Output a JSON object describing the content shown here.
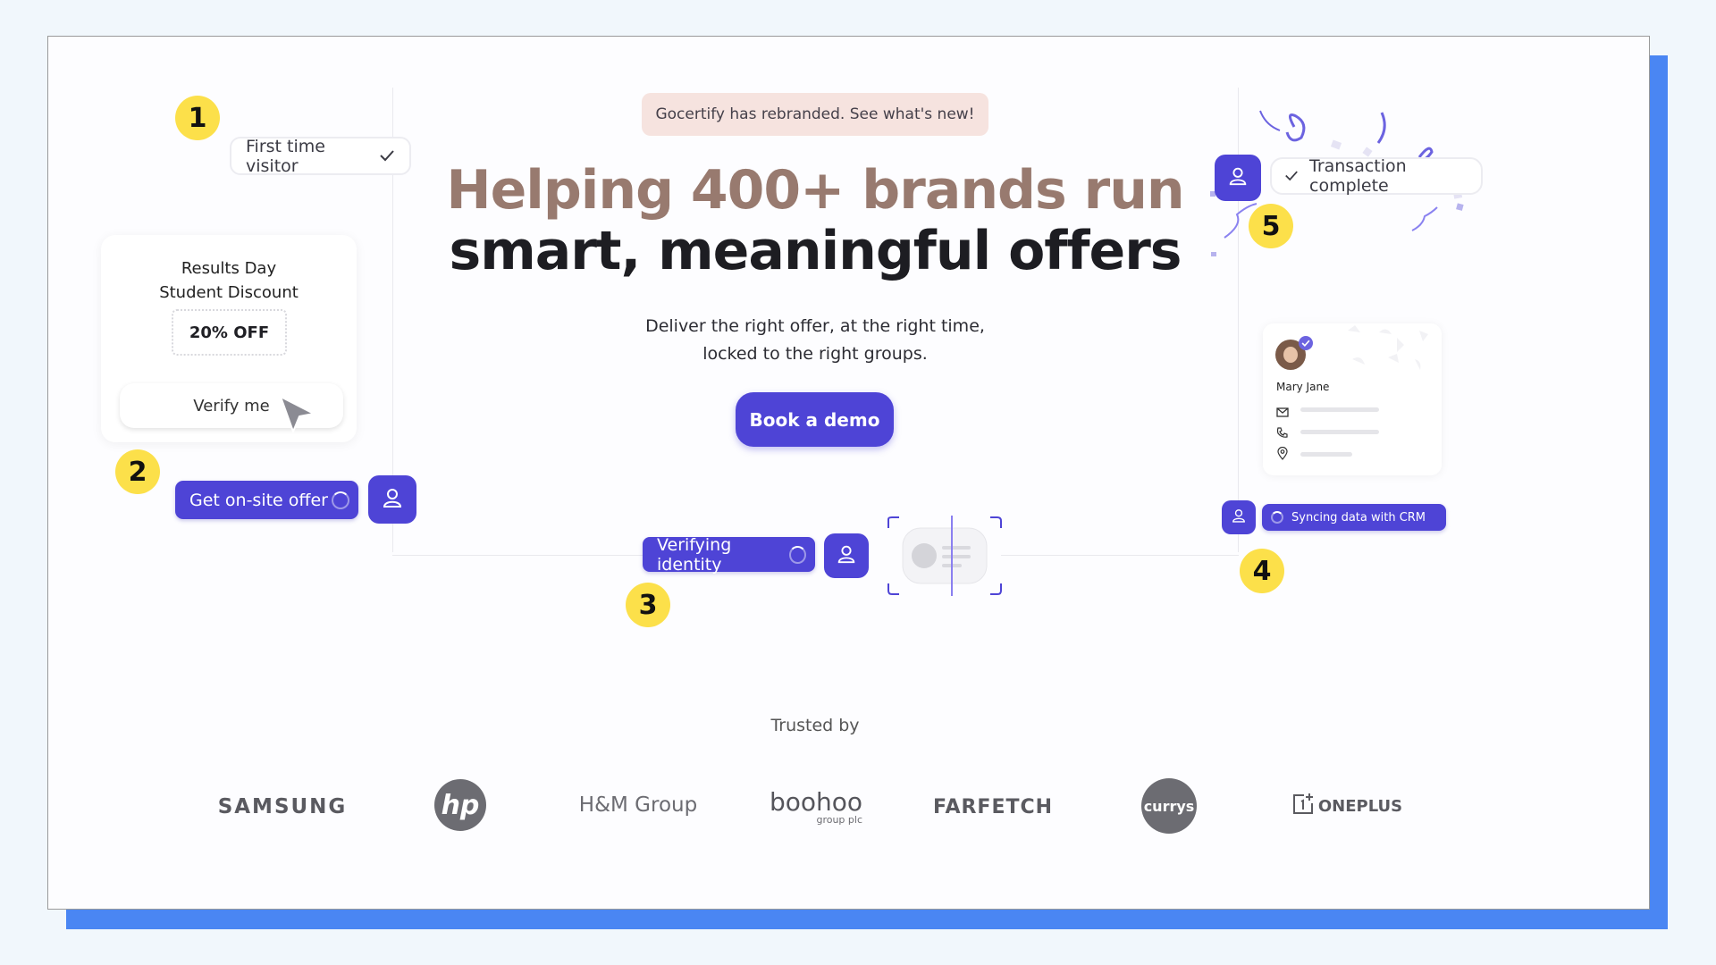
{
  "announcement": "Gocertify has rebranded. See what's new!",
  "hero": {
    "line1": "Helping 400+ brands run",
    "line2": "smart, meaningful offers",
    "subtitle_line1": "Deliver the right offer, at the right time,",
    "subtitle_line2": "locked to the right groups.",
    "cta": "Book a demo"
  },
  "steps": {
    "one": {
      "number": "1",
      "label": "First time visitor"
    },
    "two": {
      "number": "2",
      "card_title_line1": "Results Day",
      "card_title_line2": "Student Discount",
      "discount": "20% OFF",
      "verify_label": "Verify me",
      "offer_label": "Get on-site offer"
    },
    "three": {
      "number": "3",
      "label": "Verifying identity"
    },
    "four": {
      "number": "4",
      "label": "Syncing data with CRM",
      "profile_name": "Mary Jane"
    },
    "five": {
      "number": "5",
      "label": "Transaction complete"
    }
  },
  "trusted": {
    "heading": "Trusted by",
    "logos": [
      "SAMSUNG",
      "hp",
      "H&M Group",
      "boohoo",
      "group plc",
      "FARFETCH",
      "currys",
      "ONEPLUS"
    ]
  },
  "colors": {
    "accent": "#4e44d6",
    "badge": "#fce04a",
    "frame_shadow": "#4a86f3",
    "announcement_bg": "#f6e3df",
    "hero_line1": "#987a6f"
  },
  "icons": {
    "check": "check-icon",
    "user": "user-icon",
    "spinner": "spinner-icon",
    "cursor": "cursor-arrow-icon",
    "mail": "mail-icon",
    "phone": "phone-icon",
    "location": "location-pin-icon",
    "verified": "verified-badge-icon",
    "face_scan": "face-scan-icon"
  }
}
